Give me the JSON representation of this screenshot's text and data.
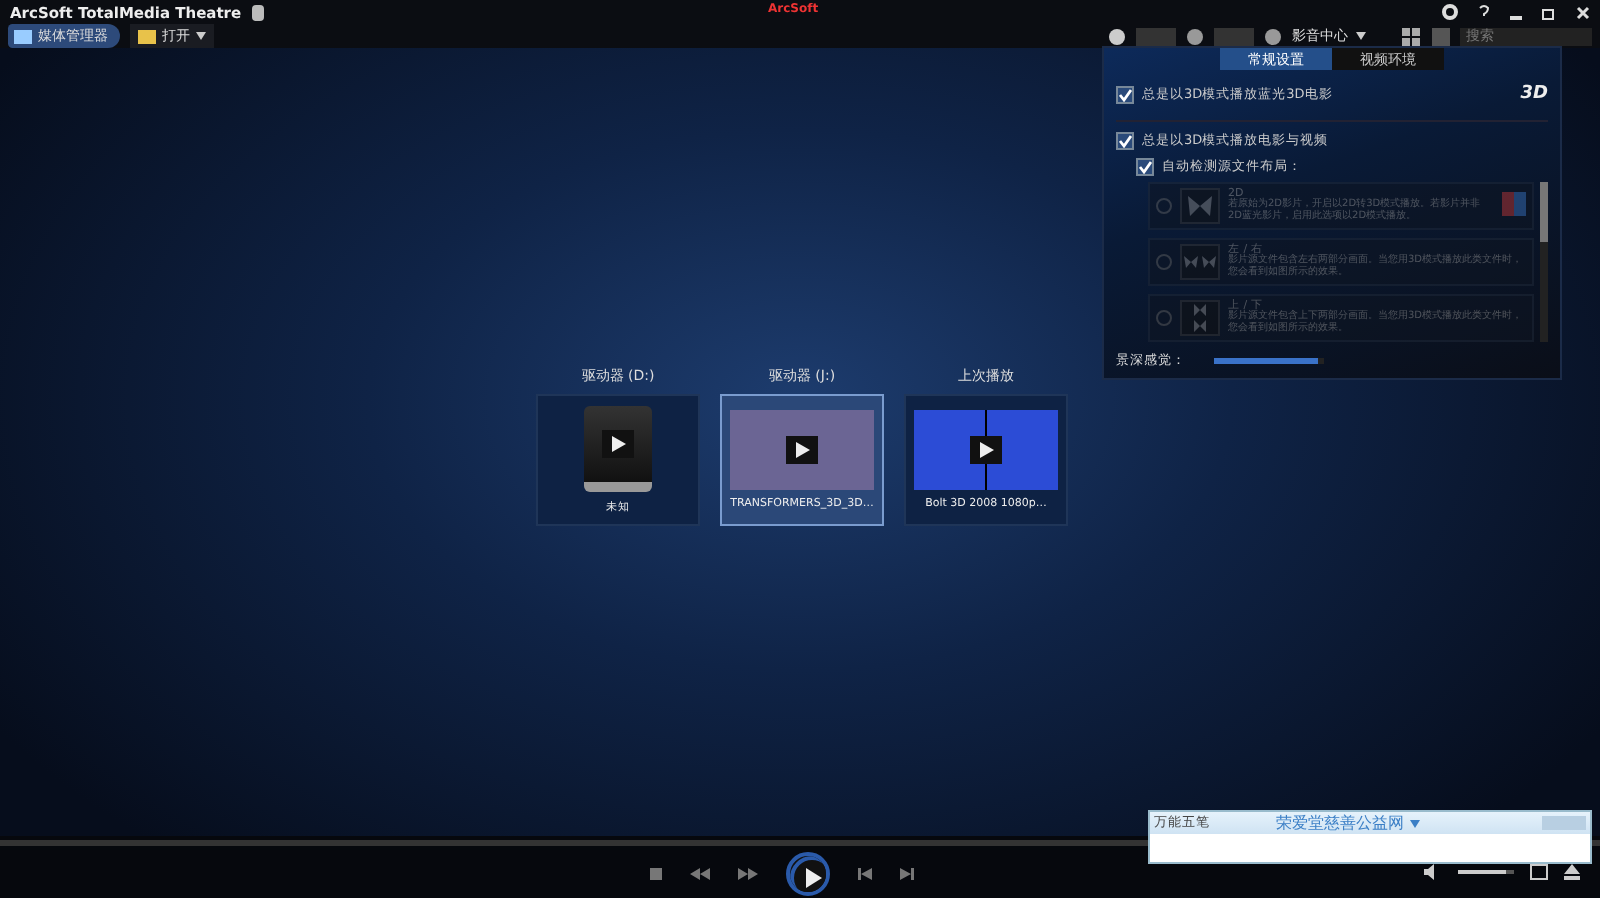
{
  "window": {
    "title": "ArcSoft TotalMedia Theatre",
    "logo": "ArcSoft"
  },
  "toolbar": {
    "breadcrumb": "媒体管理器",
    "open_menu": "打开",
    "view_menu": "影音中心",
    "search": {
      "placeholder": "搜索"
    }
  },
  "media": [
    {
      "title": "驱动器 (D:)",
      "caption": "未知",
      "kind": "disc",
      "selected": false
    },
    {
      "title": "驱动器 (J:)",
      "caption": "TRANSFORMERS_3D_3D…",
      "kind": "noise",
      "selected": true
    },
    {
      "title": "上次播放",
      "caption": "Bolt 3D 2008 1080p…",
      "kind": "split",
      "selected": false
    }
  ],
  "settings": {
    "badge": "3D",
    "tabs": [
      {
        "label": "常规设置",
        "selected": true
      },
      {
        "label": "视频环境",
        "selected": false
      }
    ],
    "options": [
      {
        "label": "总是以3D模式播放蓝光3D电影",
        "checked": true
      },
      {
        "label": "总是以3D模式播放电影与视频",
        "checked": true
      },
      {
        "label": "自动检测源文件布局：",
        "checked": true
      }
    ],
    "layouts": [
      {
        "title": "2D",
        "description": "若原始为2D影片，开启以2D转3D模式播放。若影片并非2D蓝光影片，启用此选项以2D模式播放。",
        "kind": "single",
        "selected": false,
        "disabled": true
      },
      {
        "title": "左 / 右",
        "description": "影片源文件包含左右两部分画面。当您用3D模式播放此类文件时，您会看到如图所示的效果。",
        "kind": "side",
        "selected": false,
        "disabled": true
      },
      {
        "title": "上 / 下",
        "description": "影片源文件包含上下两部分画面。当您用3D模式播放此类文件时，您会看到如图所示的效果。",
        "kind": "stack",
        "selected": false,
        "disabled": true
      }
    ],
    "depth": {
      "label": "景深感觉：",
      "level": 0.95
    }
  },
  "player": {
    "volume": {
      "level": 0.85
    }
  },
  "ime": {
    "name": "万能五笔",
    "link": "荣爱堂慈善公益网"
  }
}
